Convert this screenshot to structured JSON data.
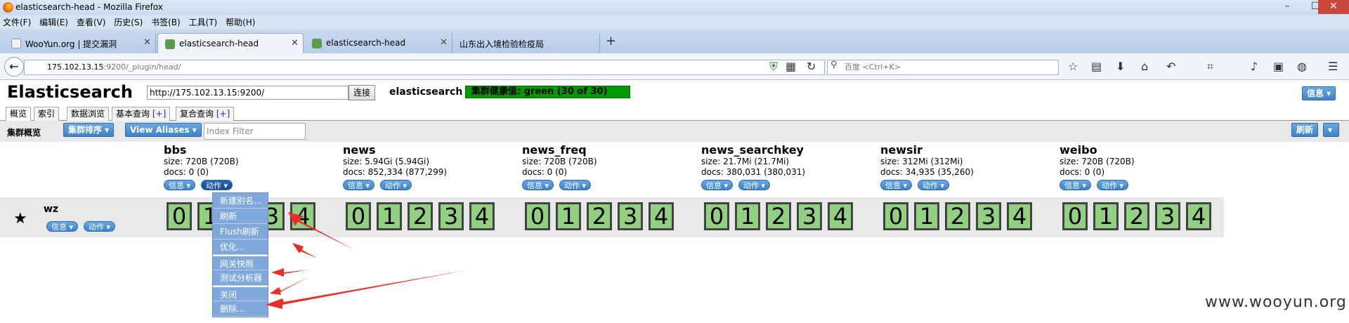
{
  "window": {
    "title": "elasticsearch-head - Mozilla Firefox"
  },
  "menu": [
    "文件(F)",
    "编辑(E)",
    "查看(V)",
    "历史(S)",
    "书签(B)",
    "工具(T)",
    "帮助(H)"
  ],
  "tabs": [
    {
      "label": "WooYun.org | 提交漏洞"
    },
    {
      "label": "elasticsearch-head"
    },
    {
      "label": "elasticsearch-head"
    },
    {
      "label": "山东出入境检验检疫局"
    }
  ],
  "address": {
    "host": "175.102.13.15",
    "rest": ":9200/_plugin/head/"
  },
  "search": {
    "placeholder": "百度 <Ctrl+K>"
  },
  "es": {
    "title": "Elasticsearch",
    "url_value": "http://175.102.13.15:9200/",
    "connect_label": "连接",
    "cluster_name": "elasticsearch",
    "health": "集群健康值: green (30 of 30)",
    "info_label": "信息 ▾"
  },
  "es_tabs": {
    "overview": "概览",
    "indices": "索引",
    "browser": "数据浏览",
    "basic_query": "基本查询",
    "complex_query": "复合查询",
    "plus": "[+]"
  },
  "toolbar": {
    "label": "集群概览",
    "sort_label": "集群排序 ▾",
    "aliases_label": "View Aliases ▾",
    "filter_placeholder": "Index Filter",
    "refresh_label": "刷新",
    "dropdown_caret": "▾"
  },
  "indices": [
    {
      "name": "bbs",
      "size": "size: 720B (720B)",
      "docs": "docs: 0 (0)"
    },
    {
      "name": "news",
      "size": "size: 5.94Gi (5.94Gi)",
      "docs": "docs: 852,334 (877,299)"
    },
    {
      "name": "news_freq",
      "size": "size: 720B (720B)",
      "docs": "docs: 0 (0)"
    },
    {
      "name": "news_searchkey",
      "size": "size: 21.7Mi (21.7Mi)",
      "docs": "docs: 380,031 (380,031)"
    },
    {
      "name": "newsir",
      "size": "size: 312Mi (312Mi)",
      "docs": "docs: 34,935 (35,260)"
    },
    {
      "name": "weibo",
      "size": "size: 720B (720B)",
      "docs": "docs: 0 (0)"
    }
  ],
  "index_buttons": {
    "info": "信息 ▾",
    "action": "动作 ▾"
  },
  "node": {
    "star": "★",
    "name": "wz",
    "info": "信息 ▾",
    "action": "动作 ▾"
  },
  "shards": [
    "0",
    "1",
    "2",
    "3",
    "4"
  ],
  "action_menu": [
    "新建别名...",
    "刷新",
    "Flush刷新",
    "优化...",
    "网关快照",
    "测试分析器",
    "关闭",
    "删除..."
  ],
  "watermark": "www.wooyun.org"
}
